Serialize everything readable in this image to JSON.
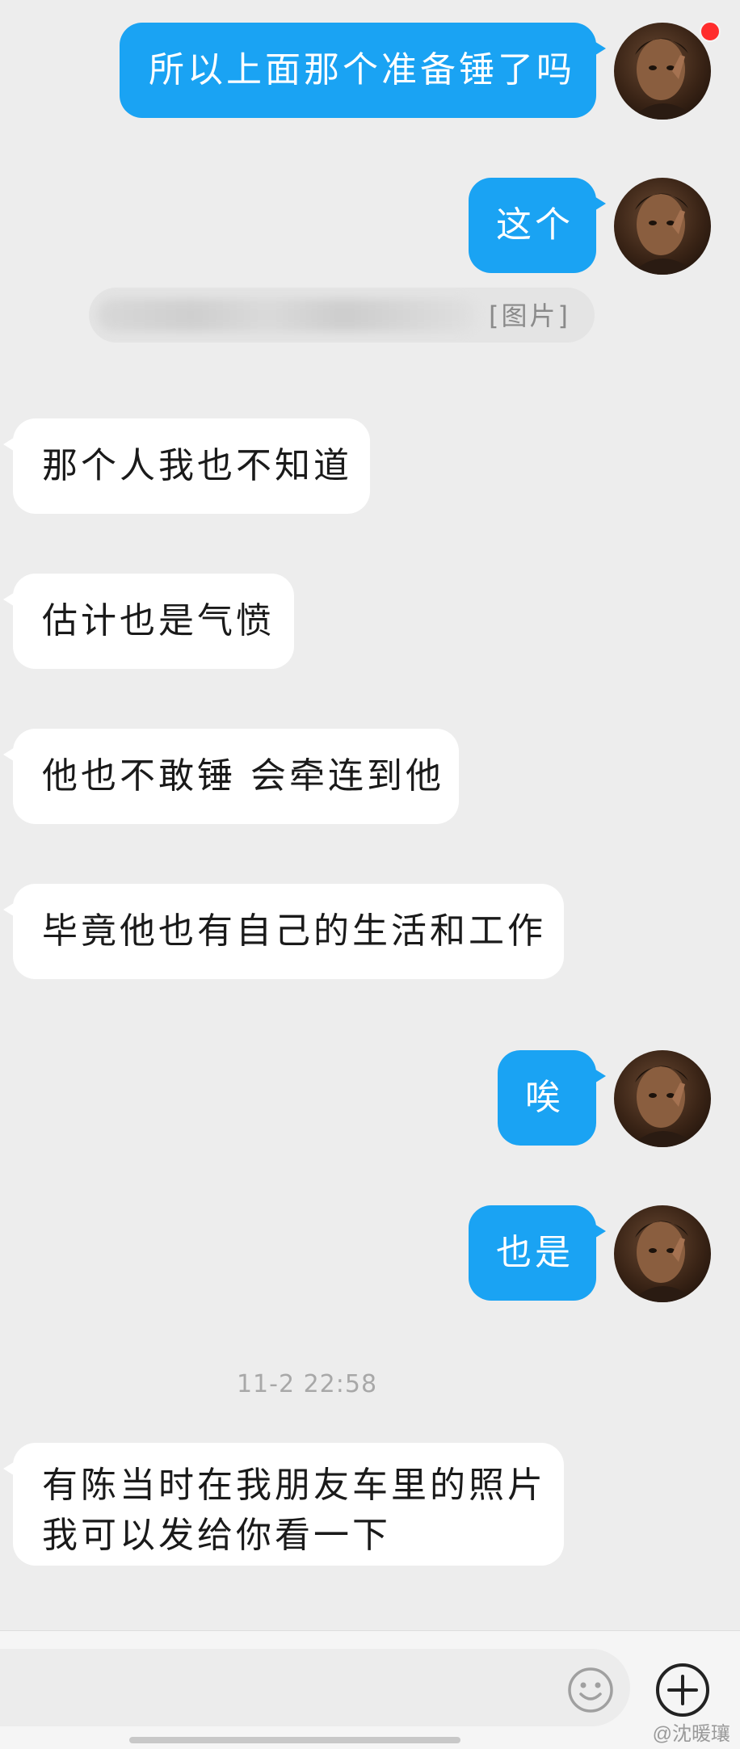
{
  "messages": [
    {
      "dir": "out",
      "text": "所以上面那个准备锤了吗"
    },
    {
      "dir": "out",
      "text": "这个"
    },
    {
      "dir": "out",
      "type": "image",
      "text": "[图片]"
    },
    {
      "dir": "in",
      "text": "那个人我也不知道"
    },
    {
      "dir": "in",
      "text": "估计也是气愤"
    },
    {
      "dir": "in",
      "text": "他也不敢锤 会牵连到他"
    },
    {
      "dir": "in",
      "text": "毕竟他也有自己的生活和工作"
    },
    {
      "dir": "out",
      "text": "唉"
    },
    {
      "dir": "out",
      "text": "也是"
    },
    {
      "dir": "in",
      "text": "有陈当时在我朋友车里的照片",
      "text2": "我可以发给你看一下"
    }
  ],
  "timestamp": "11-2 22:58",
  "input_bar": {
    "emoji_icon": "smiley-icon",
    "plus_icon": "plus-circle-icon"
  },
  "watermark": "@沈暖瓖",
  "colors": {
    "background": "#ededed",
    "outgoing_bubble": "#1aa3f3",
    "incoming_bubble": "#ffffff",
    "badge": "#ff2d2d"
  }
}
